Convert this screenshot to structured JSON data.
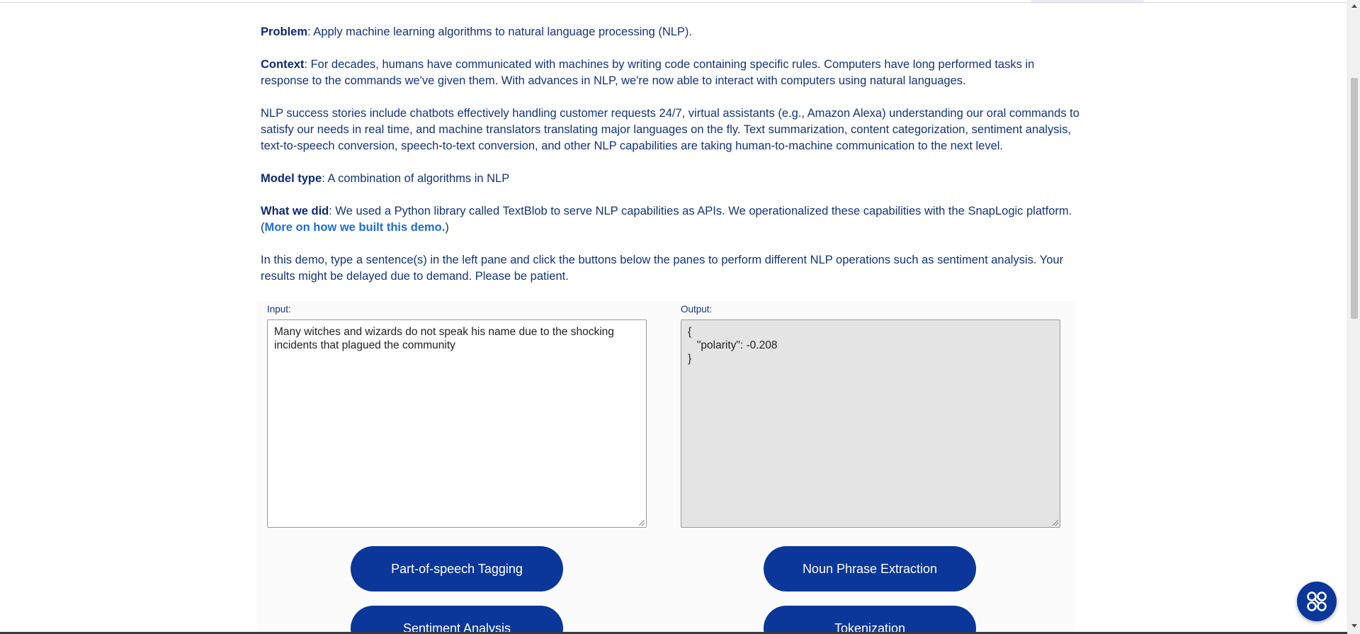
{
  "article": {
    "problem": {
      "label": "Problem",
      "text": ": Apply machine learning algorithms to natural language processing (NLP)."
    },
    "context": {
      "label": "Context",
      "text": ": For decades, humans have communicated with machines by writing code containing specific rules. Computers have long performed tasks in response to the commands we've given them. With advances in NLP, we're now able to interact with computers using natural languages."
    },
    "success": "NLP success stories include chatbots effectively handling customer requests 24/7, virtual assistants (e.g., Amazon Alexa) understanding our oral commands to satisfy our needs in real time, and machine translators translating major languages on the fly. Text summarization, content categorization, sentiment analysis, text-to-speech conversion, speech-to-text conversion, and other NLP capabilities are taking human-to-machine communication to the next level.",
    "model_type": {
      "label": "Model type",
      "text": ": A combination of algorithms in NLP"
    },
    "what_we_did": {
      "label": "What we did",
      "text": ": We used a Python library called TextBlob to serve NLP capabilities as APIs. We operationalized these capabilities with the SnapLogic platform. (",
      "link": "More on how we built this demo.",
      "after": ")"
    },
    "instructions": "In this demo, type a sentence(s) in the left pane and click the buttons below the panes to perform different NLP operations such as sentiment analysis. Your results might be delayed due to demand. Please be patient."
  },
  "demo": {
    "input_label": "Input:",
    "input_value": "Many witches and wizards do not speak his name due to the shocking incidents that plagued the community",
    "output_label": "Output:",
    "output_value": "{\n   \"polarity\": -0.208\n}",
    "buttons": {
      "pos_tagging": "Part-of-speech Tagging",
      "noun_phrase": "Noun Phrase Extraction",
      "sentiment": "Sentiment Analysis",
      "tokenization": "Tokenization"
    }
  },
  "colors": {
    "primary": "#0a3799",
    "text": "#13357a",
    "link": "#1d6fd6"
  },
  "icons": {
    "fab": "snaplogic-chat-icon"
  }
}
